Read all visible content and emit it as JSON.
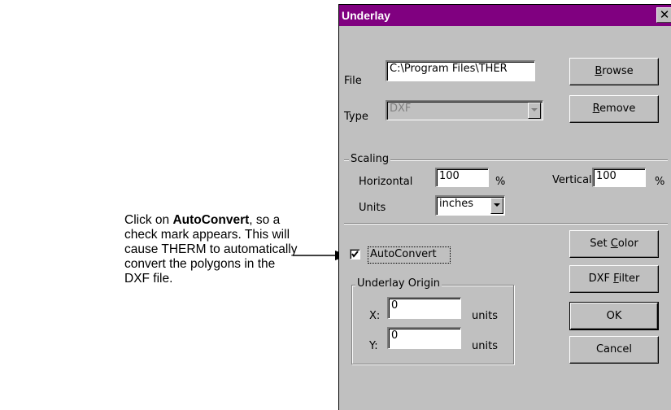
{
  "callout": {
    "prefix": "Click on ",
    "bold": "AutoConvert",
    "suffix": ", so  a check mark appears. This will cause THERM to automatically convert the polygons in the DXF file."
  },
  "dialog": {
    "title": "Underlay",
    "close_glyph": "✕",
    "file": {
      "label": "File",
      "value": "C:\\Program Files\\THER"
    },
    "type": {
      "label": "Type",
      "value": "DXF",
      "enabled": false
    },
    "buttons": {
      "browse": {
        "pre": "",
        "key": "B",
        "post": "rowse"
      },
      "remove": {
        "pre": "",
        "key": "R",
        "post": "emove"
      },
      "set_color": {
        "pre": "Set ",
        "key": "C",
        "post": "olor"
      },
      "dxf_filter": {
        "pre": "DXF ",
        "key": "F",
        "post": "ilter"
      },
      "ok": "OK",
      "cancel": "Cancel"
    },
    "scaling": {
      "title": "Scaling",
      "horizontal_label": "Horizontal",
      "horizontal_value": "100",
      "horizontal_unit": "%",
      "vertical_label": "Vertical",
      "vertical_value": "100",
      "vertical_unit": "%",
      "units_label": "Units",
      "units_value": "inches"
    },
    "autoconvert": {
      "label": "AutoConvert",
      "checked": true
    },
    "origin": {
      "title": "Underlay Origin",
      "x_label": "X:",
      "x_value": "0",
      "x_unit": "units",
      "y_label": "Y:",
      "y_value": "0",
      "y_unit": "units"
    }
  }
}
